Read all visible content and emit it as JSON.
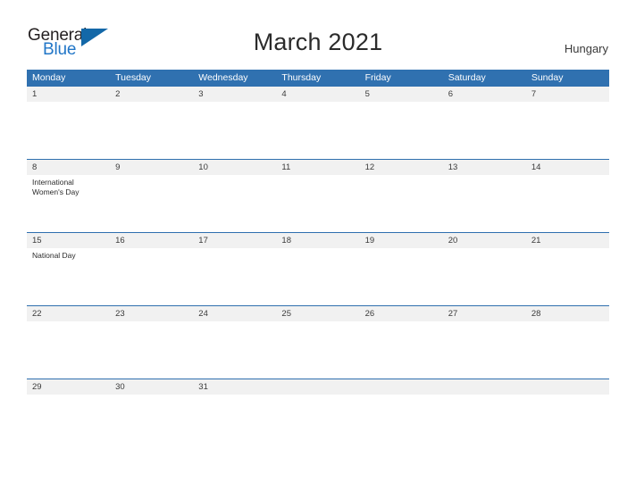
{
  "brand": {
    "name_part1": "General",
    "name_part2": "Blue",
    "triangle_icon": "triangle-icon",
    "colors": {
      "dark_text": "#231f20",
      "blue_text": "#2176c7",
      "triangle": "#1368a8"
    }
  },
  "header": {
    "title": "March 2021",
    "country": "Hungary"
  },
  "calendar": {
    "header_color": "#3071b0",
    "date_band_color": "#f1f1f1",
    "weekdays": [
      "Monday",
      "Tuesday",
      "Wednesday",
      "Thursday",
      "Friday",
      "Saturday",
      "Sunday"
    ],
    "weeks": [
      {
        "days": [
          {
            "num": "1",
            "event": ""
          },
          {
            "num": "2",
            "event": ""
          },
          {
            "num": "3",
            "event": ""
          },
          {
            "num": "4",
            "event": ""
          },
          {
            "num": "5",
            "event": ""
          },
          {
            "num": "6",
            "event": ""
          },
          {
            "num": "7",
            "event": ""
          }
        ]
      },
      {
        "days": [
          {
            "num": "8",
            "event": "International Women's Day"
          },
          {
            "num": "9",
            "event": ""
          },
          {
            "num": "10",
            "event": ""
          },
          {
            "num": "11",
            "event": ""
          },
          {
            "num": "12",
            "event": ""
          },
          {
            "num": "13",
            "event": ""
          },
          {
            "num": "14",
            "event": ""
          }
        ]
      },
      {
        "days": [
          {
            "num": "15",
            "event": "National Day"
          },
          {
            "num": "16",
            "event": ""
          },
          {
            "num": "17",
            "event": ""
          },
          {
            "num": "18",
            "event": ""
          },
          {
            "num": "19",
            "event": ""
          },
          {
            "num": "20",
            "event": ""
          },
          {
            "num": "21",
            "event": ""
          }
        ]
      },
      {
        "days": [
          {
            "num": "22",
            "event": ""
          },
          {
            "num": "23",
            "event": ""
          },
          {
            "num": "24",
            "event": ""
          },
          {
            "num": "25",
            "event": ""
          },
          {
            "num": "26",
            "event": ""
          },
          {
            "num": "27",
            "event": ""
          },
          {
            "num": "28",
            "event": ""
          }
        ]
      },
      {
        "days": [
          {
            "num": "29",
            "event": ""
          },
          {
            "num": "30",
            "event": ""
          },
          {
            "num": "31",
            "event": ""
          },
          {
            "num": "",
            "event": ""
          },
          {
            "num": "",
            "event": ""
          },
          {
            "num": "",
            "event": ""
          },
          {
            "num": "",
            "event": ""
          }
        ]
      }
    ]
  }
}
